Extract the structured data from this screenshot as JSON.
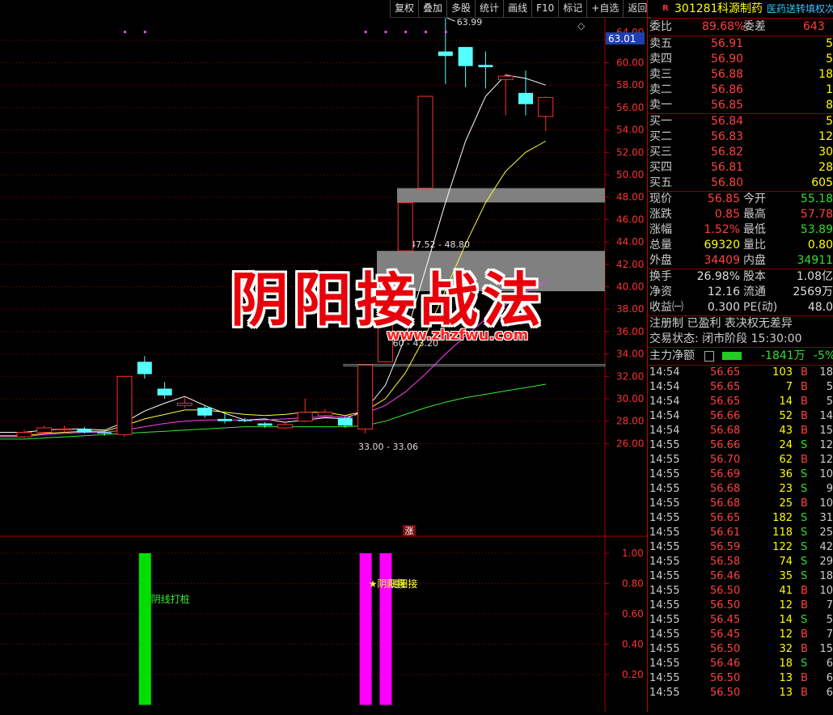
{
  "toolbar": {
    "items": [
      "复权",
      "叠加",
      "多股",
      "统计",
      "画线",
      "F10",
      "标记",
      "+自选",
      "返回"
    ]
  },
  "chart": {
    "yaxis_ticks": [
      "62.00",
      "60.00",
      "58.00",
      "56.00",
      "54.00",
      "52.00",
      "50.00",
      "48.00",
      "46.00",
      "44.00",
      "42.00",
      "40.00",
      "38.00",
      "36.00",
      "34.00",
      "32.00",
      "30.00",
      "28.00",
      "26.00"
    ],
    "current_price_tag": "63.01",
    "partial_top_tick": "64.00",
    "high_label": "63.99",
    "zone_labels": [
      "47.52 - 48.80",
      "39.60 - 43.20",
      "33.00 - 33.06"
    ],
    "zhang_badge": "涨",
    "diamond_icon": "◇"
  },
  "indicator": {
    "yaxis_ticks": [
      "1.00",
      "0.80",
      "0.60",
      "0.40",
      "0.20"
    ],
    "label_green": "阴线打桩",
    "label_magenta": "★阴阳接",
    "label_magenta2": "阴阳接"
  },
  "overlay": {
    "title": "阴阳接战法",
    "site": "www.zhzfwu.com"
  },
  "quote": {
    "badge": "R",
    "code": "301281",
    "name": "科源制药",
    "tag": "医药送转填权次",
    "weibi_label": "委比",
    "weibi": "89.68%",
    "weicha_label": "委差",
    "weicha": "643",
    "asks": [
      {
        "label": "卖五",
        "price": "56.91",
        "vol": "5"
      },
      {
        "label": "卖四",
        "price": "56.90",
        "vol": "5"
      },
      {
        "label": "卖三",
        "price": "56.88",
        "vol": "18"
      },
      {
        "label": "卖二",
        "price": "56.86",
        "vol": "1"
      },
      {
        "label": "卖一",
        "price": "56.85",
        "vol": "8"
      }
    ],
    "bids": [
      {
        "label": "买一",
        "price": "56.84",
        "vol": "5"
      },
      {
        "label": "买二",
        "price": "56.83",
        "vol": "12"
      },
      {
        "label": "买三",
        "price": "56.82",
        "vol": "30"
      },
      {
        "label": "买四",
        "price": "56.81",
        "vol": "28"
      },
      {
        "label": "买五",
        "price": "56.80",
        "vol": "605"
      }
    ],
    "stats": [
      {
        "l1": "现价",
        "v1": "56.85",
        "l2": "今开",
        "v2": "55.18"
      },
      {
        "l1": "涨跌",
        "v1": "0.85",
        "l2": "最高",
        "v2": "57.78"
      },
      {
        "l1": "涨幅",
        "v1": "1.52%",
        "l2": "最低",
        "v2": "53.89"
      },
      {
        "l1": "总量",
        "v1": "69320",
        "l2": "量比",
        "v2": "0.80"
      },
      {
        "l1": "外盘",
        "v1": "34409",
        "l2": "内盘",
        "v2": "34911"
      }
    ],
    "fin": [
      {
        "l1": "换手",
        "v1": "26.98%",
        "l2": "股本",
        "v2": "1.08亿"
      },
      {
        "l1": "净资",
        "v1": "12.16",
        "l2": "流通",
        "v2": "2569万"
      },
      {
        "l1": "收益㈠",
        "v1": "0.300",
        "l2": "PE(动)",
        "v2": "48.0"
      }
    ],
    "reg": "注册制 已盈利 表决权无差异",
    "trade_state": "交易状态: 闭市阶段 15:30:00",
    "mainflow_label": "主力净额",
    "mainflow_value": "-1841万",
    "mainflow_pct": "-5%"
  },
  "ticks": [
    {
      "t": "14:54",
      "p": "56.65",
      "v": "103",
      "d": "B",
      "n": "18"
    },
    {
      "t": "14:54",
      "p": "56.65",
      "v": "7",
      "d": "B",
      "n": "5"
    },
    {
      "t": "14:54",
      "p": "56.65",
      "v": "14",
      "d": "B",
      "n": "5"
    },
    {
      "t": "14:54",
      "p": "56.66",
      "v": "52",
      "d": "B",
      "n": "14"
    },
    {
      "t": "14:54",
      "p": "56.68",
      "v": "43",
      "d": "B",
      "n": "15"
    },
    {
      "t": "14:55",
      "p": "56.66",
      "v": "24",
      "d": "S",
      "n": "12"
    },
    {
      "t": "14:55",
      "p": "56.70",
      "v": "62",
      "d": "B",
      "n": "12"
    },
    {
      "t": "14:55",
      "p": "56.69",
      "v": "36",
      "d": "S",
      "n": "10"
    },
    {
      "t": "14:55",
      "p": "56.68",
      "v": "23",
      "d": "S",
      "n": "9"
    },
    {
      "t": "14:55",
      "p": "56.68",
      "v": "25",
      "d": "B",
      "n": "10"
    },
    {
      "t": "14:55",
      "p": "56.65",
      "v": "182",
      "d": "S",
      "n": "31"
    },
    {
      "t": "14:55",
      "p": "56.61",
      "v": "118",
      "d": "S",
      "n": "25"
    },
    {
      "t": "14:55",
      "p": "56.59",
      "v": "122",
      "d": "S",
      "n": "42"
    },
    {
      "t": "14:55",
      "p": "56.58",
      "v": "74",
      "d": "S",
      "n": "29"
    },
    {
      "t": "14:55",
      "p": "56.46",
      "v": "35",
      "d": "S",
      "n": "18"
    },
    {
      "t": "14:55",
      "p": "56.50",
      "v": "41",
      "d": "B",
      "n": "10"
    },
    {
      "t": "14:55",
      "p": "56.50",
      "v": "12",
      "d": "B",
      "n": "7"
    },
    {
      "t": "14:55",
      "p": "56.45",
      "v": "14",
      "d": "S",
      "n": "5"
    },
    {
      "t": "14:55",
      "p": "56.45",
      "v": "12",
      "d": "B",
      "n": "7"
    },
    {
      "t": "14:55",
      "p": "56.50",
      "v": "32",
      "d": "B",
      "n": "15"
    },
    {
      "t": "14:55",
      "p": "56.46",
      "v": "18",
      "d": "S",
      "n": "6"
    },
    {
      "t": "14:55",
      "p": "56.50",
      "v": "13",
      "d": "B",
      "n": "6"
    },
    {
      "t": "14:55",
      "p": "56.50",
      "v": "13",
      "d": "B",
      "n": "6"
    }
  ],
  "colors": {
    "up": "#ff3030",
    "down": "#54ffff",
    "ma_white": "#ffffff",
    "ma_yellow": "#ffff40",
    "ma_magenta": "#ff40ff",
    "ma_green": "#33ee33",
    "zone": "#808080",
    "grid": "#8b0000"
  },
  "candles": [
    {
      "o": 26.6,
      "c": 27.0,
      "h": 27.2,
      "l": 26.5
    },
    {
      "o": 27.0,
      "c": 27.4,
      "h": 27.6,
      "l": 26.9
    },
    {
      "o": 27.3,
      "c": 27.3,
      "h": 27.6,
      "l": 27.0
    },
    {
      "o": 27.3,
      "c": 27.0,
      "h": 27.5,
      "l": 26.9
    },
    {
      "o": 27.0,
      "c": 26.9,
      "h": 27.2,
      "l": 26.7
    },
    {
      "o": 26.8,
      "c": 32.0,
      "h": 32.0,
      "l": 26.6
    },
    {
      "o": 33.3,
      "c": 32.2,
      "h": 33.8,
      "l": 31.8
    },
    {
      "o": 30.9,
      "c": 30.3,
      "h": 31.5,
      "l": 30.0
    },
    {
      "o": 29.4,
      "c": 29.6,
      "h": 30.1,
      "l": 29.2
    },
    {
      "o": 29.2,
      "c": 28.5,
      "h": 29.4,
      "l": 28.3
    },
    {
      "o": 28.2,
      "c": 28.0,
      "h": 28.7,
      "l": 27.8
    },
    {
      "o": 28.1,
      "c": 28.0,
      "h": 28.3,
      "l": 27.9
    },
    {
      "o": 27.8,
      "c": 27.6,
      "h": 27.9,
      "l": 27.4
    },
    {
      "o": 27.4,
      "c": 27.7,
      "h": 28.0,
      "l": 27.3
    },
    {
      "o": 28.0,
      "c": 28.8,
      "h": 30.0,
      "l": 27.9
    },
    {
      "o": 28.5,
      "c": 28.8,
      "h": 29.1,
      "l": 28.3
    },
    {
      "o": 28.3,
      "c": 27.6,
      "h": 28.4,
      "l": 27.4
    },
    {
      "o": 27.3,
      "c": 33.0,
      "h": 33.0,
      "l": 26.9
    },
    {
      "o": 33.3,
      "c": 39.6,
      "h": 39.6,
      "l": 33.3
    },
    {
      "o": 43.2,
      "c": 47.5,
      "h": 47.5,
      "l": 43.2
    },
    {
      "o": 48.8,
      "c": 57.0,
      "h": 57.0,
      "l": 48.8
    },
    {
      "o": 61.0,
      "c": 60.6,
      "h": 63.99,
      "l": 58.1
    },
    {
      "o": 61.4,
      "c": 59.7,
      "h": 61.4,
      "l": 57.8
    },
    {
      "o": 59.8,
      "c": 59.6,
      "h": 61.0,
      "l": 57.7
    },
    {
      "o": 58.5,
      "c": 58.8,
      "h": 59.0,
      "l": 55.3
    },
    {
      "o": 57.3,
      "c": 56.3,
      "h": 59.3,
      "l": 55.3
    },
    {
      "o": 55.2,
      "c": 56.9,
      "h": 57.0,
      "l": 53.9
    }
  ],
  "ma": {
    "white": [
      27.0,
      27.2,
      27.3,
      27.3,
      27.2,
      27.9,
      28.9,
      29.6,
      30.2,
      29.4,
      28.7,
      28.1,
      28.2,
      27.9,
      28.1,
      28.3,
      28.2,
      29.0,
      31.2,
      35.5,
      41.5,
      47.5,
      53.0,
      57.0,
      58.9,
      58.6,
      58.0
    ],
    "yellow": [
      26.7,
      26.9,
      27.0,
      27.1,
      27.1,
      27.6,
      28.2,
      28.6,
      29.0,
      29.0,
      28.8,
      28.6,
      28.5,
      28.6,
      28.8,
      28.8,
      28.5,
      28.9,
      30.0,
      32.3,
      35.6,
      39.7,
      43.8,
      47.5,
      50.3,
      52.0,
      53.0
    ],
    "magenta": [
      26.6,
      26.8,
      26.9,
      27.0,
      27.0,
      27.2,
      27.5,
      27.8,
      28.0,
      28.1,
      28.1,
      28.1,
      28.1,
      28.2,
      28.3,
      28.4,
      28.4,
      28.7,
      29.4,
      30.6,
      32.2,
      34.0,
      35.6,
      37.1,
      38.4,
      39.5,
      40.5
    ],
    "green": [
      26.4,
      26.5,
      26.6,
      26.7,
      26.8,
      26.9,
      27.0,
      27.1,
      27.2,
      27.3,
      27.4,
      27.5,
      27.5,
      27.5,
      27.5,
      27.5,
      27.5,
      27.6,
      28.0,
      28.6,
      29.2,
      29.7,
      30.1,
      30.4,
      30.7,
      31.0,
      31.3
    ]
  },
  "signals": [
    {
      "index": 6,
      "value": 1.0,
      "color": "green"
    },
    {
      "index": 17,
      "value": 1.0,
      "color": "magenta"
    },
    {
      "index": 18,
      "value": 1.0,
      "color": "magenta"
    }
  ],
  "top_dots": [
    5,
    6,
    17,
    18,
    19,
    20,
    21
  ]
}
